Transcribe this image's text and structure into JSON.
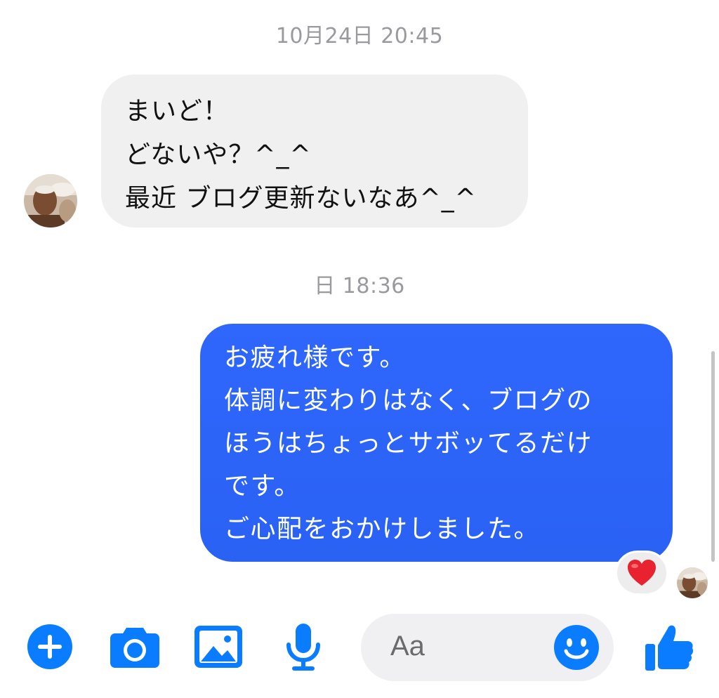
{
  "conversation": {
    "timestamps": [
      "10月24日 20:45",
      "日 18:36"
    ],
    "incoming": {
      "lines": [
        "まいど！",
        "どないや？^_^",
        "最近 ブログ更新ないなあ^_^"
      ]
    },
    "outgoing": {
      "lines": [
        "お疲れ様です。",
        "体調に変わりはなく、ブログの",
        "ほうはちょっとサボッてるだけ",
        "です。",
        "ご心配をおかけしました。"
      ],
      "reaction": "heart"
    }
  },
  "composer": {
    "placeholder": "Aa",
    "icons": [
      "plus-icon",
      "camera-icon",
      "gallery-icon",
      "mic-icon",
      "emoji-icon",
      "thumbs-up-icon"
    ]
  },
  "colors": {
    "accent": "#0a7cff",
    "outgoing_bubble": "#2f66fc",
    "incoming_bubble": "#f0f0f0",
    "timestamp": "#9a9a9e",
    "heart": "#e8222e"
  }
}
